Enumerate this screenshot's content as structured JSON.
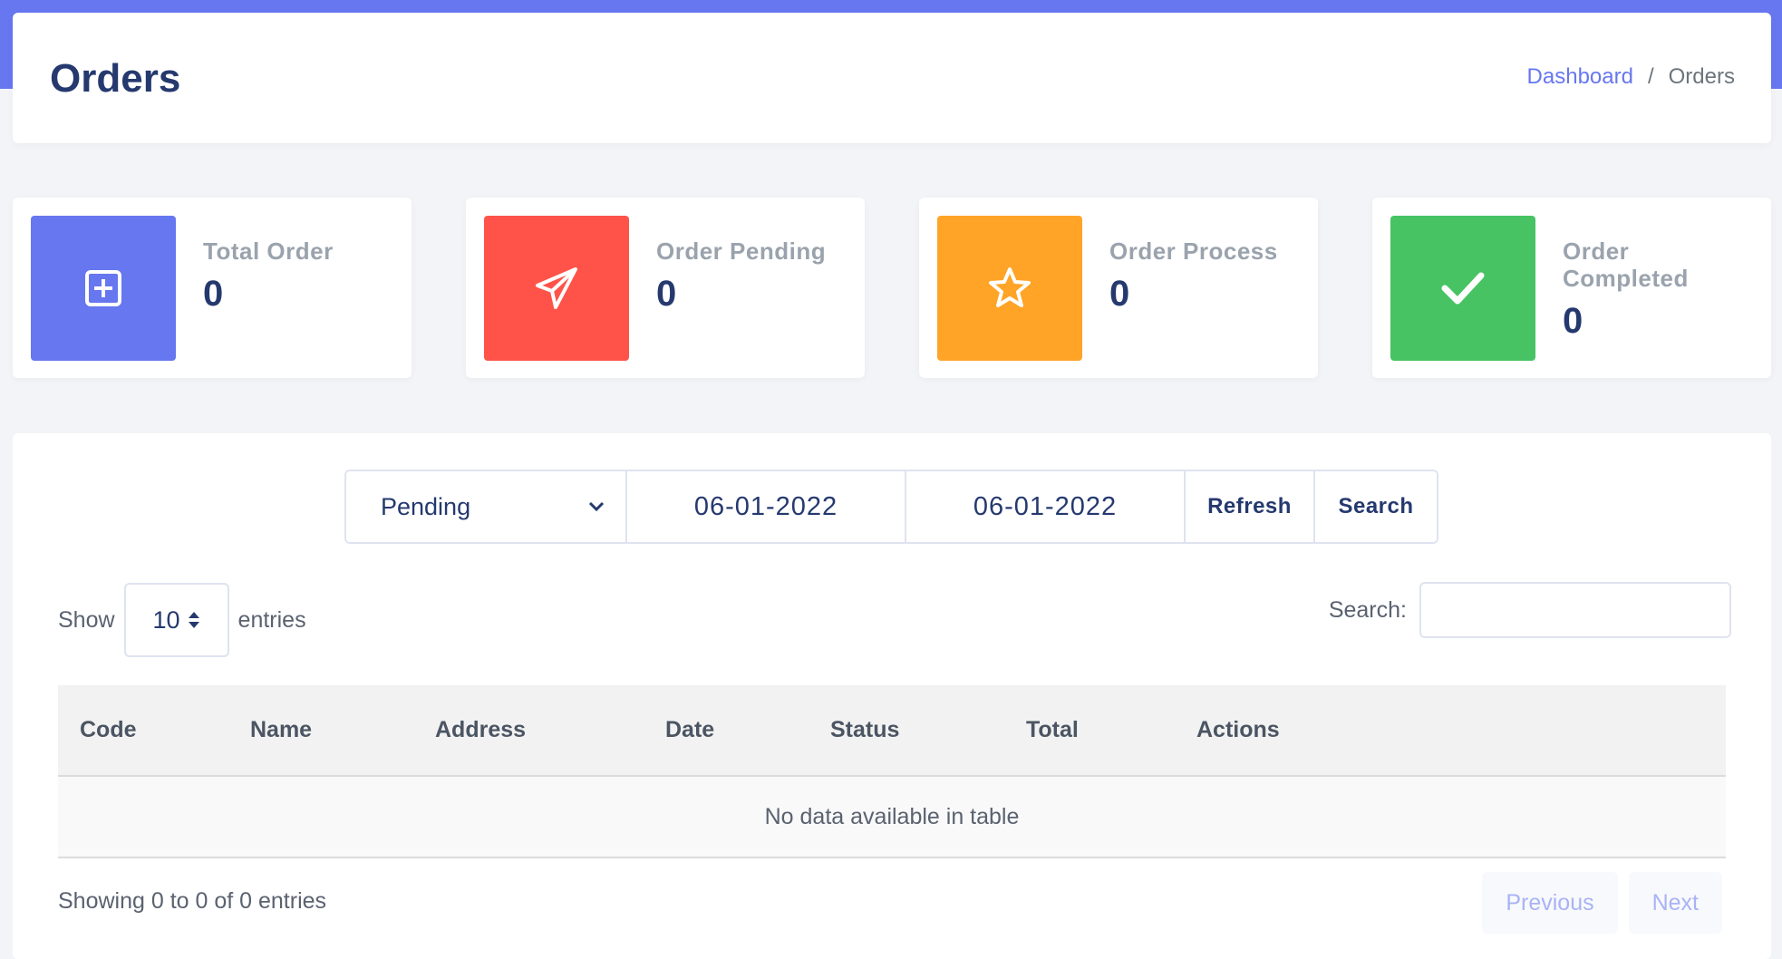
{
  "header": {
    "title": "Orders",
    "breadcrumb": {
      "link": "Dashboard",
      "separator": "/",
      "current": "Orders"
    }
  },
  "stats": [
    {
      "label": "Total Order",
      "value": "0",
      "color": "#6777ef",
      "icon": "plus-square-icon"
    },
    {
      "label": "Order Pending",
      "value": "0",
      "color": "#ff5349",
      "icon": "paper-plane-icon"
    },
    {
      "label": "Order Process",
      "value": "0",
      "color": "#ffa426",
      "icon": "star-icon"
    },
    {
      "label": "Order Completed",
      "value": "0",
      "color": "#47c363",
      "icon": "check-icon"
    }
  ],
  "filters": {
    "status_selected": "Pending",
    "date_from": "06-01-2022",
    "date_to": "06-01-2022",
    "refresh_label": "Refresh",
    "search_label": "Search"
  },
  "table_controls": {
    "show_label": "Show",
    "entries_value": "10",
    "entries_label": "entries",
    "search_label": "Search:"
  },
  "table": {
    "columns": [
      "Code",
      "Name",
      "Address",
      "Date",
      "Status",
      "Total",
      "Actions"
    ],
    "empty_message": "No data available in table"
  },
  "footer": {
    "info": "Showing 0 to 0 of 0 entries",
    "previous_label": "Previous",
    "next_label": "Next"
  }
}
